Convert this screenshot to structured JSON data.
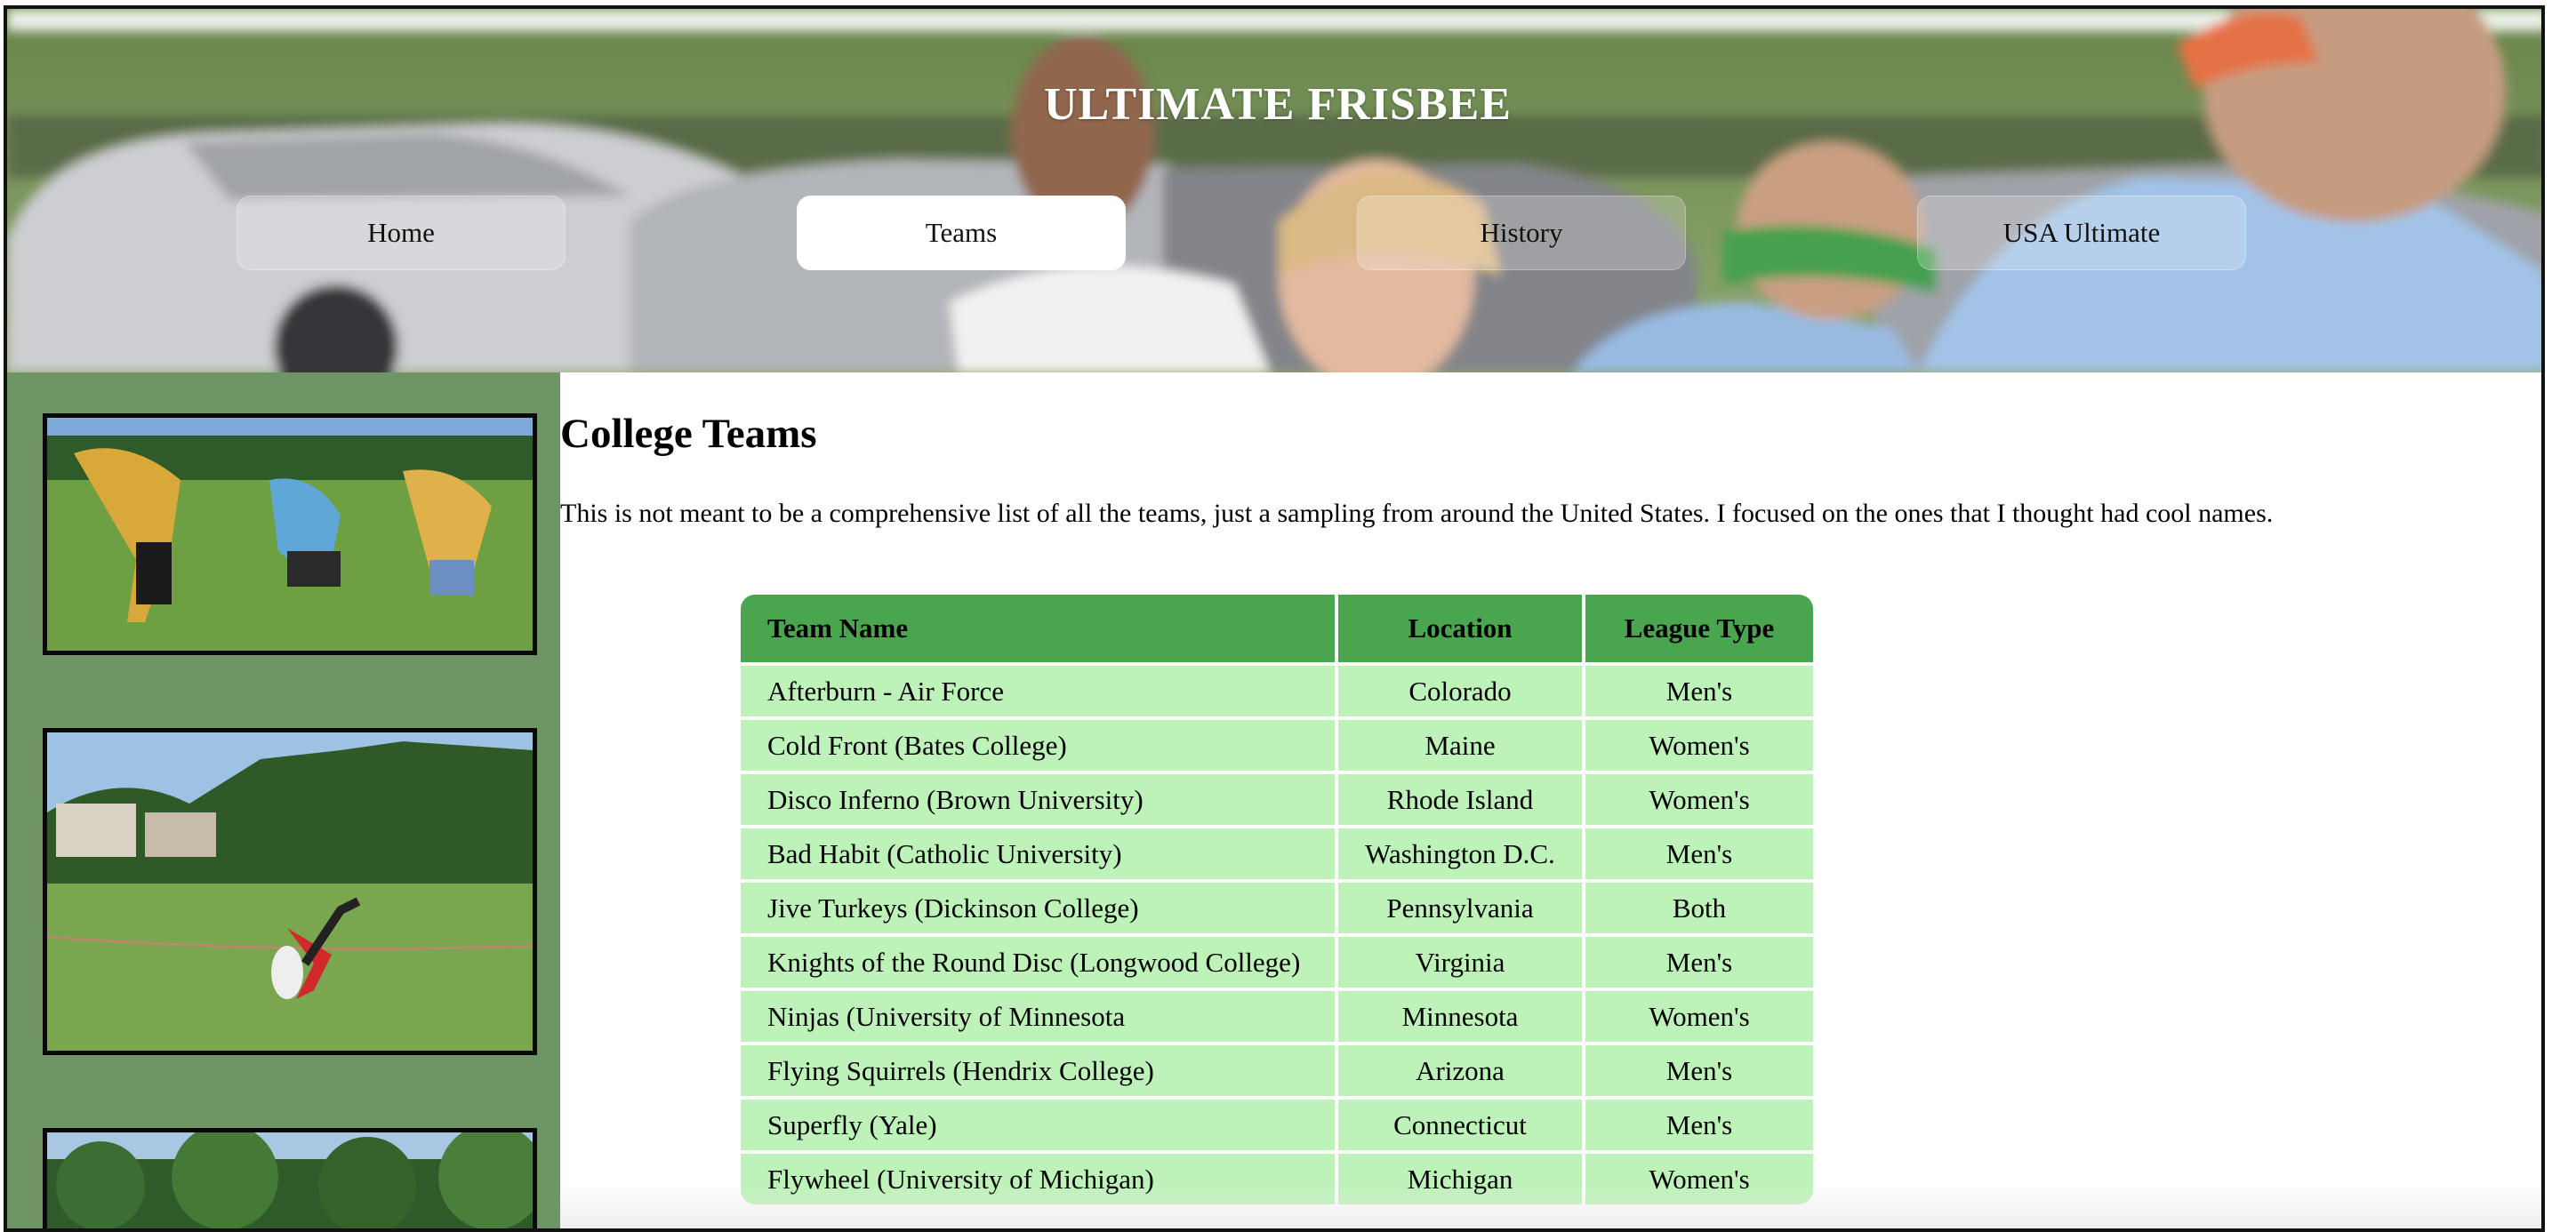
{
  "header": {
    "title": "ULTIMATE FRISBEE",
    "nav": [
      {
        "label": "Home",
        "active": false
      },
      {
        "label": "Teams",
        "active": true
      },
      {
        "label": "History",
        "active": false
      },
      {
        "label": "USA Ultimate",
        "active": false
      }
    ]
  },
  "main": {
    "title": "College Teams",
    "intro": "This is not meant to be a comprehensive list of all the teams, just a sampling from around the United States. I focused on the ones that I thought had cool names.",
    "table": {
      "headers": [
        "Team Name",
        "Location",
        "League Type"
      ],
      "rows": [
        [
          "Afterburn - Air Force",
          "Colorado",
          "Men's"
        ],
        [
          "Cold Front (Bates College)",
          "Maine",
          "Women's"
        ],
        [
          "Disco Inferno (Brown University)",
          "Rhode Island",
          "Women's"
        ],
        [
          "Bad Habit (Catholic University)",
          "Washington D.C.",
          "Men's"
        ],
        [
          "Jive Turkeys (Dickinson College)",
          "Pennsylvania",
          "Both"
        ],
        [
          "Knights of the Round Disc (Longwood College)",
          "Virginia",
          "Men's"
        ],
        [
          "Ninjas (University of Minnesota",
          "Minnesota",
          "Women's"
        ],
        [
          "Flying Squirrels (Hendrix College)",
          "Arizona",
          "Men's"
        ],
        [
          "Superfly (Yale)",
          "Connecticut",
          "Men's"
        ],
        [
          "Flywheel (University of Michigan)",
          "Michigan",
          "Women's"
        ]
      ]
    }
  },
  "colors": {
    "sidebar": "#6f9466",
    "table_header": "#4aa64e",
    "table_row": "#bdf3b8",
    "nav_active": "#ffffff"
  }
}
